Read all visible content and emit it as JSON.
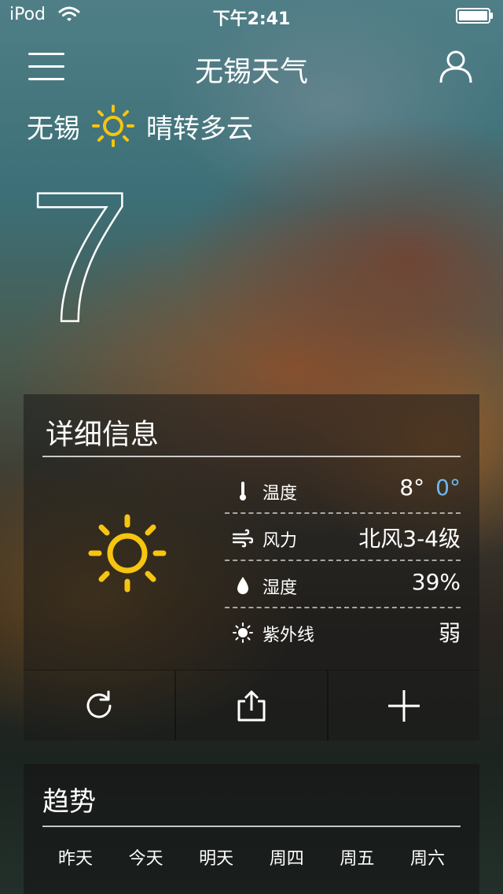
{
  "status_bar": {
    "carrier": "iPod",
    "time": "下午2:41"
  },
  "nav": {
    "title": "无锡天气"
  },
  "location": {
    "city": "无锡",
    "condition": "晴转多云",
    "condition_icon": "sun-icon"
  },
  "current_temp": 7,
  "details": {
    "title": "详细信息",
    "rows": [
      {
        "icon": "thermometer-icon",
        "label": "温度",
        "high": "8°",
        "low": "0°"
      },
      {
        "icon": "wind-icon",
        "label": "风力",
        "value": "北风3-4级"
      },
      {
        "icon": "drop-icon",
        "label": "湿度",
        "value": "39%"
      },
      {
        "icon": "uv-sun-icon",
        "label": "紫外线",
        "value": "弱"
      }
    ]
  },
  "actions": [
    {
      "icon": "refresh-icon"
    },
    {
      "icon": "share-icon"
    },
    {
      "icon": "add-icon"
    }
  ],
  "trend": {
    "title": "趋势",
    "days": [
      "昨天",
      "今天",
      "明天",
      "周四",
      "周五",
      "周六"
    ]
  },
  "colors": {
    "sun": "#f6c50f",
    "low_temp": "#6fb7ef"
  }
}
